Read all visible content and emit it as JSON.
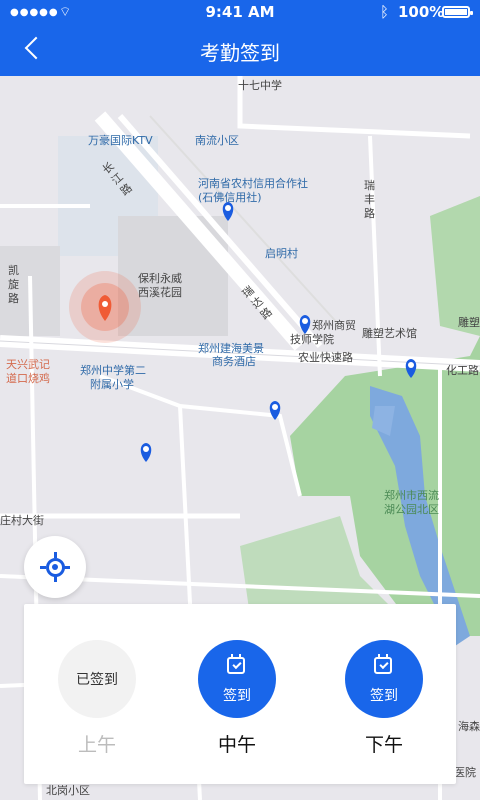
{
  "status_bar": {
    "time": "9:41 AM",
    "battery": "100%"
  },
  "nav": {
    "title": "考勤签到"
  },
  "map": {
    "labels": {
      "school_17": "十七中学",
      "ktv": "万豪国际KTV",
      "nanliu": "南流小区",
      "bank1": "河南省农村信用合作社",
      "bank2": "(石佛信用社)",
      "ruifeng": "瑞\n丰\n路",
      "changjiang": "长\n江\n路",
      "qiming": "启明村",
      "kaixuan": "凯\n旋\n路",
      "baoli1": "保利永威",
      "baoli2": "西溪花园",
      "diaosu": "雕塑艺术馆",
      "diaosu2": "雕塑",
      "ruida": "瑞\n达\n路",
      "jishu1": "郑州商贸",
      "jishu2": "技师学院",
      "hotel1": "郑州建海美景",
      "hotel2": "商务酒店",
      "nongye": "农业快速路",
      "huagong": "化工路",
      "tianxing1": "天兴武记",
      "tianxing2": "道口烧鸡",
      "zz_school1": "郑州中学第二",
      "zz_school2": "附属小学",
      "park1": "郑州市西流",
      "park2": "湖公园北区",
      "zhuangcun": "庄村大街",
      "beinan": "北岗小区",
      "haisen": "海森",
      "hospital": "医院"
    }
  },
  "panel": {
    "slots": [
      {
        "circle_label": "已签到",
        "period": "上午"
      },
      {
        "circle_label": "签到",
        "period": "中午"
      },
      {
        "circle_label": "签到",
        "period": "下午"
      }
    ]
  },
  "icons": {
    "back": "back-arrow-icon",
    "locate": "locate-crosshair-icon",
    "calendar": "calendar-check-icon",
    "user_pin": "user-location-pin-icon",
    "checkin_pin": "checkin-pin-icon"
  },
  "colors": {
    "brand": "#1966ea",
    "pin": "#1a5ce0",
    "user_pin": "#f05b35",
    "water": "#7ea9dd",
    "park": "#9ccf9a"
  }
}
